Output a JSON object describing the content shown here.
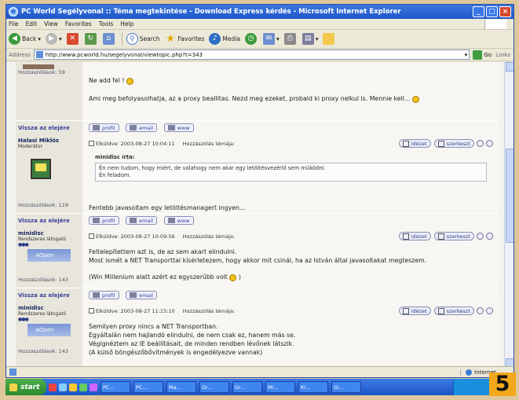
{
  "window": {
    "title": "PC World Segélyvonal :: Téma megtekintése - Download Express kérdés - Microsoft Internet Explorer"
  },
  "menu": [
    "File",
    "Edit",
    "View",
    "Favorites",
    "Tools",
    "Help"
  ],
  "toolbar": {
    "back": "Back",
    "search": "Search",
    "favorites": "Favorites",
    "media": "Media"
  },
  "address": {
    "label": "Address",
    "url": "http://www.pcworld.hu/segelyvonal/viewtopic.php?t=343",
    "go": "Go",
    "links": "Links"
  },
  "forum": {
    "back_to_top": "Vissza az elejére",
    "buttons": {
      "profile": "profil",
      "email": "email",
      "www": "www",
      "quote": "idézet",
      "edit": "szerkeszt"
    },
    "posts_label": "Hozzászólások:",
    "post0": {
      "posts": "59",
      "lines": [
        "Ne add fel !",
        "Ami meg befolyasolhatja, az a proxy beallitas. Nezd meg ezeket, probald ki proxy nelkul is. Mennie kell..."
      ]
    },
    "post1": {
      "username": "Halasi Miklós",
      "rank": "Moderátor",
      "posts": "119",
      "header": "Elküldve: 2003-08-27 10:04:11",
      "subject": "Hozzászólás témája:",
      "quote_title": "minidisc írta:",
      "quote_lines": [
        "Én nem tudom, hogy miért, de valahogy nem akar egy letöltésvezérlő sem működni.",
        "Én feladom."
      ],
      "text": "Fentebb javasoltam egy letöltésmanagert ingyen..."
    },
    "post2": {
      "username": "minidisc",
      "rank": "Rendszeres látogató",
      "avatar": "AOpen",
      "posts": "143",
      "header": "Elküldve: 2003-08-27 10:09:56",
      "subject": "Hozzászólás témája:",
      "lines": [
        "Feltelepítettem azt is, de az sem akart elindulni.",
        "Most ismét a NET Transporttal kísérletezem, hogy akkor mit csinál, ha az István által javasoltakat megteszem.",
        "",
        "(Win Millenium alatt azért ez egyszerűbb volt"
      ]
    },
    "post3": {
      "username": "minidisc",
      "rank": "Rendszeres látogató",
      "avatar": "AOpen",
      "posts": "143",
      "header": "Elküldve: 2003-08-27 11:15:10",
      "subject": "Hozzászólás témája:",
      "lines": [
        "Semilyen proxy nincs a NET Transportban.",
        "Egyáltalán nem hajlandó elindulni, de nem csak ez, hanem más se.",
        "Végignéztem az IE beállításait, de minden rendben lévőnek látszik.",
        "(A külső böngészőbővítmények is engedélyezve vannak)"
      ]
    }
  },
  "status": {
    "zone": "Internet"
  },
  "taskbar": {
    "start": "start",
    "tasks": [
      "PC...",
      "PC...",
      "Ma...",
      "Gr...",
      "Gr...",
      "Mi...",
      "Ki...",
      "Gi..."
    ]
  },
  "badge": "5"
}
